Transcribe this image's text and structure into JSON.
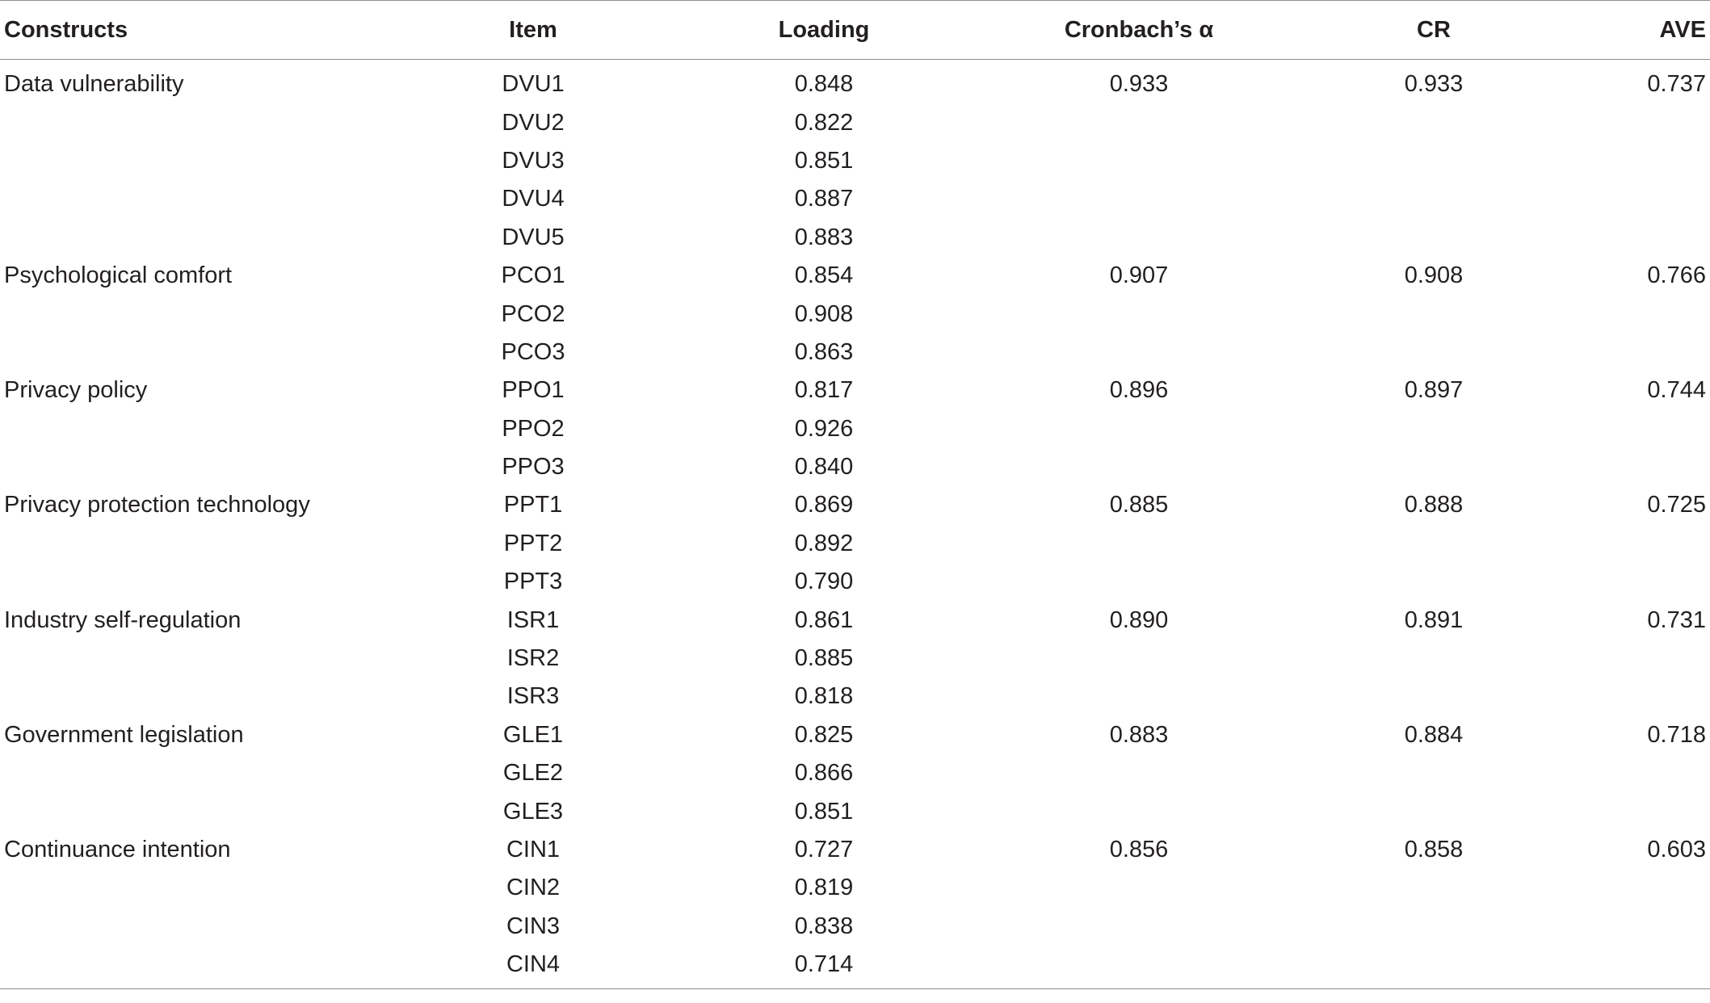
{
  "table": {
    "headers": {
      "construct": "Constructs",
      "item": "Item",
      "loading": "Loading",
      "alpha": "Cronbach’s α",
      "cr": "CR",
      "ave": "AVE"
    },
    "rows": [
      {
        "construct": "Data vulnerability",
        "item": "DVU1",
        "loading": "0.848",
        "alpha": "0.933",
        "cr": "0.933",
        "ave": "0.737"
      },
      {
        "construct": "",
        "item": "DVU2",
        "loading": "0.822",
        "alpha": "",
        "cr": "",
        "ave": ""
      },
      {
        "construct": "",
        "item": "DVU3",
        "loading": "0.851",
        "alpha": "",
        "cr": "",
        "ave": ""
      },
      {
        "construct": "",
        "item": "DVU4",
        "loading": "0.887",
        "alpha": "",
        "cr": "",
        "ave": ""
      },
      {
        "construct": "",
        "item": "DVU5",
        "loading": "0.883",
        "alpha": "",
        "cr": "",
        "ave": ""
      },
      {
        "construct": "Psychological comfort",
        "item": "PCO1",
        "loading": "0.854",
        "alpha": "0.907",
        "cr": "0.908",
        "ave": "0.766"
      },
      {
        "construct": "",
        "item": "PCO2",
        "loading": "0.908",
        "alpha": "",
        "cr": "",
        "ave": ""
      },
      {
        "construct": "",
        "item": "PCO3",
        "loading": "0.863",
        "alpha": "",
        "cr": "",
        "ave": ""
      },
      {
        "construct": "Privacy policy",
        "item": "PPO1",
        "loading": "0.817",
        "alpha": "0.896",
        "cr": "0.897",
        "ave": "0.744"
      },
      {
        "construct": "",
        "item": "PPO2",
        "loading": "0.926",
        "alpha": "",
        "cr": "",
        "ave": ""
      },
      {
        "construct": "",
        "item": "PPO3",
        "loading": "0.840",
        "alpha": "",
        "cr": "",
        "ave": ""
      },
      {
        "construct": "Privacy protection technology",
        "item": "PPT1",
        "loading": "0.869",
        "alpha": "0.885",
        "cr": "0.888",
        "ave": "0.725"
      },
      {
        "construct": "",
        "item": "PPT2",
        "loading": "0.892",
        "alpha": "",
        "cr": "",
        "ave": ""
      },
      {
        "construct": "",
        "item": "PPT3",
        "loading": "0.790",
        "alpha": "",
        "cr": "",
        "ave": ""
      },
      {
        "construct": "Industry self-regulation",
        "item": "ISR1",
        "loading": "0.861",
        "alpha": "0.890",
        "cr": "0.891",
        "ave": "0.731"
      },
      {
        "construct": "",
        "item": "ISR2",
        "loading": "0.885",
        "alpha": "",
        "cr": "",
        "ave": ""
      },
      {
        "construct": "",
        "item": "ISR3",
        "loading": "0.818",
        "alpha": "",
        "cr": "",
        "ave": ""
      },
      {
        "construct": "Government legislation",
        "item": "GLE1",
        "loading": "0.825",
        "alpha": "0.883",
        "cr": "0.884",
        "ave": "0.718"
      },
      {
        "construct": "",
        "item": "GLE2",
        "loading": "0.866",
        "alpha": "",
        "cr": "",
        "ave": ""
      },
      {
        "construct": "",
        "item": "GLE3",
        "loading": "0.851",
        "alpha": "",
        "cr": "",
        "ave": ""
      },
      {
        "construct": "Continuance intention",
        "item": "CIN1",
        "loading": "0.727",
        "alpha": "0.856",
        "cr": "0.858",
        "ave": "0.603"
      },
      {
        "construct": "",
        "item": "CIN2",
        "loading": "0.819",
        "alpha": "",
        "cr": "",
        "ave": ""
      },
      {
        "construct": "",
        "item": "CIN3",
        "loading": "0.838",
        "alpha": "",
        "cr": "",
        "ave": ""
      },
      {
        "construct": "",
        "item": "CIN4",
        "loading": "0.714",
        "alpha": "",
        "cr": "",
        "ave": ""
      }
    ]
  }
}
